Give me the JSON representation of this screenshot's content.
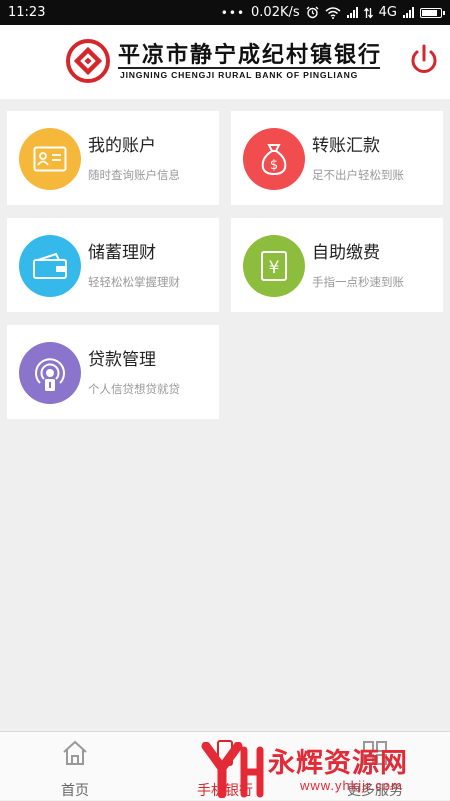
{
  "status_bar": {
    "time": "11:23",
    "dots": "•••",
    "speed": "0.02K/s",
    "network": "4G",
    "alarm_icon": "alarm-clock-icon",
    "wifi_icon": "wifi-icon",
    "battery_level": 0.9
  },
  "header": {
    "bank_name_cn": "平凉市静宁成纪村镇银行",
    "bank_name_en": "JINGNING CHENGJI RURAL BANK OF PINGLIANG",
    "logo_icon": "bank-logo-icon",
    "power_icon": "power-icon",
    "brand_color": "#d6262b"
  },
  "tiles": [
    {
      "title": "我的账户",
      "subtitle": "随时查询账户信息",
      "icon": "id-card-icon",
      "color": "#f5b83b"
    },
    {
      "title": "转账汇款",
      "subtitle": "足不出户轻松到账",
      "icon": "money-bag-icon",
      "color": "#f14d4f"
    },
    {
      "title": "储蓄理财",
      "subtitle": "轻轻松松掌握理财",
      "icon": "wallet-icon",
      "color": "#35b9ea"
    },
    {
      "title": "自助缴费",
      "subtitle": "手指一点秒速到账",
      "icon": "yen-bill-icon",
      "color": "#8cbd3d"
    },
    {
      "title": "贷款管理",
      "subtitle": "个人信贷想贷就贷",
      "icon": "signal-podcast-icon",
      "color": "#8a74cc"
    }
  ],
  "bottom_nav": [
    {
      "label": "首页",
      "icon": "home-icon",
      "active": false
    },
    {
      "label": "手机银行",
      "icon": "mobile-icon",
      "active": true
    },
    {
      "label": "更多服务",
      "icon": "grid-icon",
      "active": false
    }
  ],
  "watermark": {
    "text": "永辉资源网",
    "url": "www.yhkjjr.com"
  }
}
